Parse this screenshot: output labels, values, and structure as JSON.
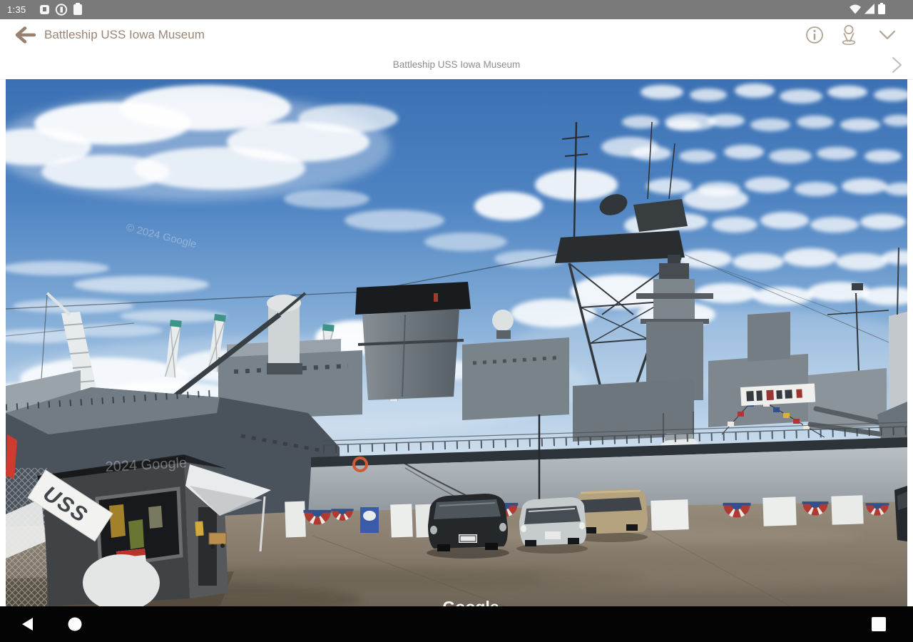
{
  "status_bar": {
    "time": "1:35"
  },
  "app_bar": {
    "title": "Battleship USS Iowa Museum"
  },
  "location_bar": {
    "title": "Battleship USS Iowa Museum"
  },
  "photo": {
    "sky_watermark": "© 2024 Google",
    "ship_watermark": "2024 Google",
    "google_logo": "Google",
    "banner_text": "USS"
  },
  "colors": {
    "accent_taupe": "#9a8474",
    "status_bar_gray": "#7a7a7a",
    "nav_bar_black": "#040404",
    "sky_blue": "#4e83c2"
  }
}
